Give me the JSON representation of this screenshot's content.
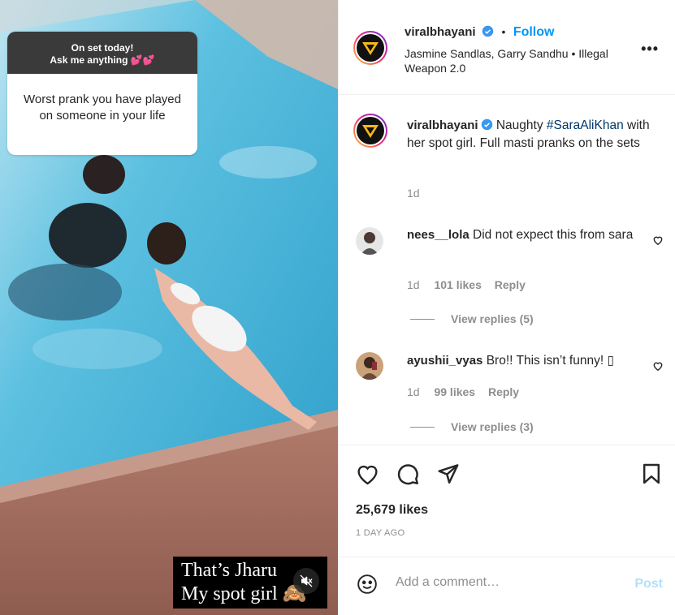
{
  "media": {
    "question_header": "On set today!\nAsk me anything 💕💕",
    "question_header_line1": "On set today!",
    "question_header_line2": "Ask me anything 💕💕",
    "question_text": "Worst prank you have played on someone in your life",
    "caption_line1": "That’s Jharu",
    "caption_line2": "My spot girl 🙈",
    "mute_icon": "speaker-muted-icon"
  },
  "header": {
    "username": "viralbhayani",
    "dot": "•",
    "follow_label": "Follow",
    "audio_line": "Jasmine Sandlas, Garry Sandhu • Illegal Weapon 2.0",
    "more_label": "•••"
  },
  "post_caption": {
    "username": "viralbhayani",
    "text_before": "Naughty ",
    "hashtag": "#SaraAliKhan",
    "text_after": " with her spot girl. Full masti pranks on the sets",
    "time": "1d"
  },
  "comments": [
    {
      "username": "nees__lola",
      "text": "Did not expect this from sara",
      "time": "1d",
      "likes": "101 likes",
      "reply_label": "Reply",
      "view_replies": "View replies (5)"
    },
    {
      "username": "ayushii_vyas",
      "text": "Bro!! This isn’t funny! ▯",
      "time": "1d",
      "likes": "99 likes",
      "reply_label": "Reply",
      "view_replies": "View replies (3)"
    }
  ],
  "actions": {
    "like_icon": "heart-icon",
    "comment_icon": "comment-bubble-icon",
    "share_icon": "paper-plane-icon",
    "save_icon": "bookmark-icon",
    "likes_count": "25,679 likes",
    "posted_ago": "1 DAY AGO"
  },
  "add_comment": {
    "emoji_icon": "smiley-icon",
    "placeholder": "Add a comment…",
    "post_label": "Post"
  },
  "colors": {
    "link_blue": "#0095f6",
    "post_disabled": "#b2dffc",
    "hashtag": "#00376b",
    "meta_grey": "#8e8e8e"
  }
}
